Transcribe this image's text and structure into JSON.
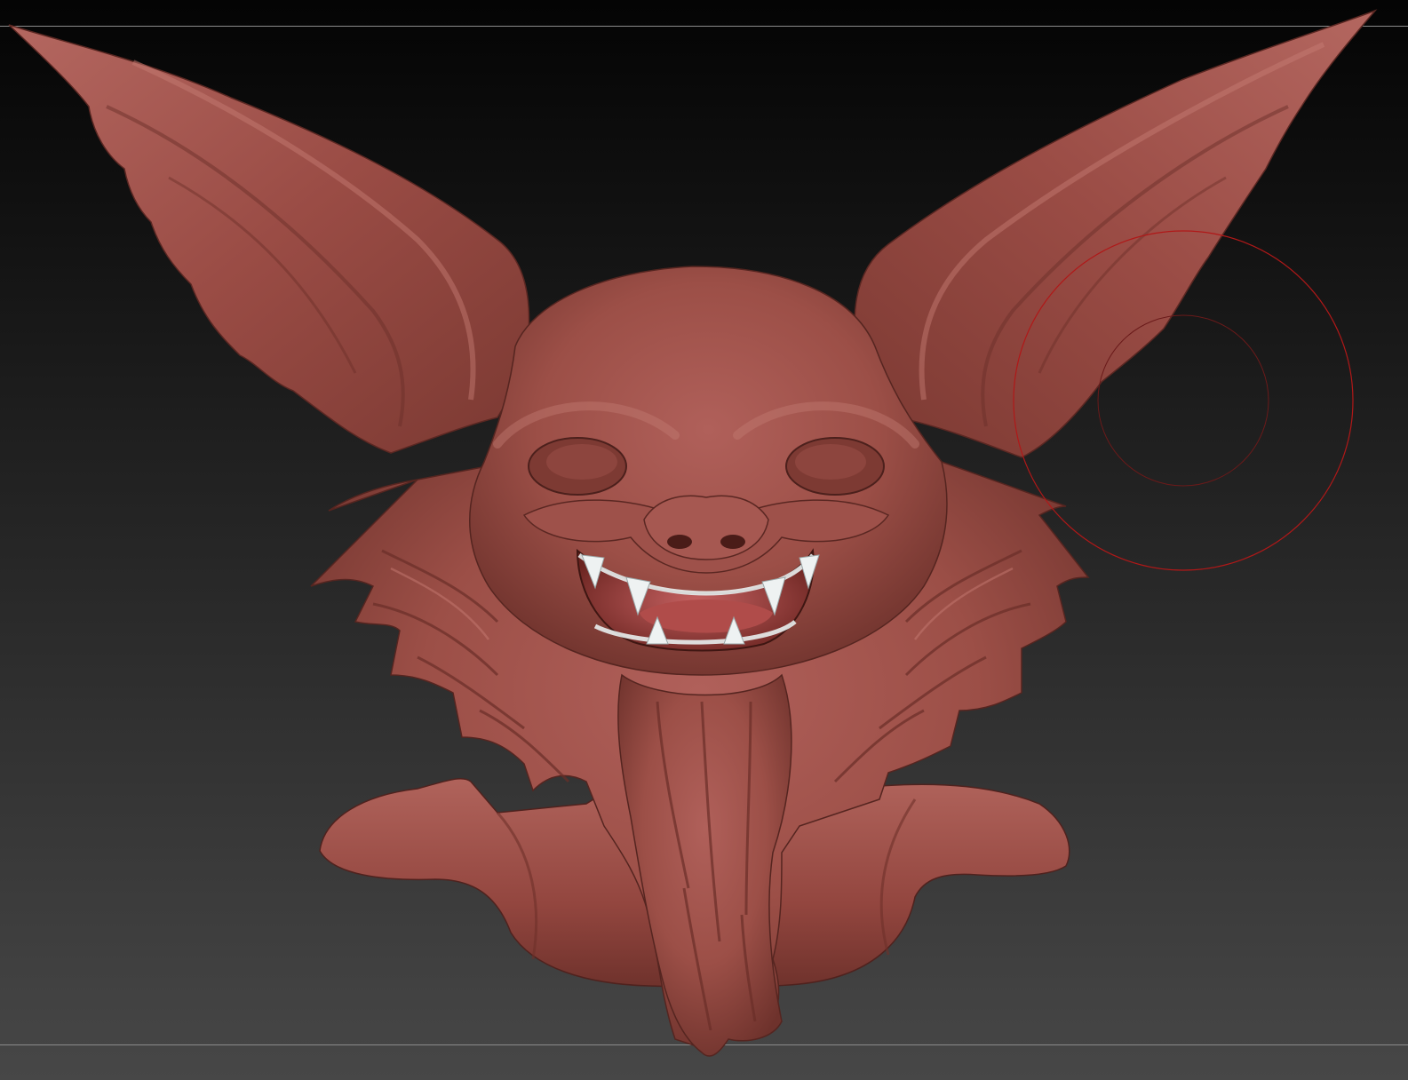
{
  "app": {
    "canvas": "zbrush-sculpt-viewport"
  },
  "model": {
    "subject": "bat-creature-bust",
    "material_color": "#9c4f47",
    "shadow_color": "#5e2a25",
    "highlight_color": "#c27a70",
    "teeth_color": "#eef2f2",
    "tongue_color": "#b04c4a"
  },
  "brush": {
    "outer_color": "#b01818",
    "inner_color": "#6a1a1a"
  },
  "colors": {
    "background_top": "#040404",
    "background_bottom": "#474747",
    "guide_line": "#8a8a8a"
  }
}
